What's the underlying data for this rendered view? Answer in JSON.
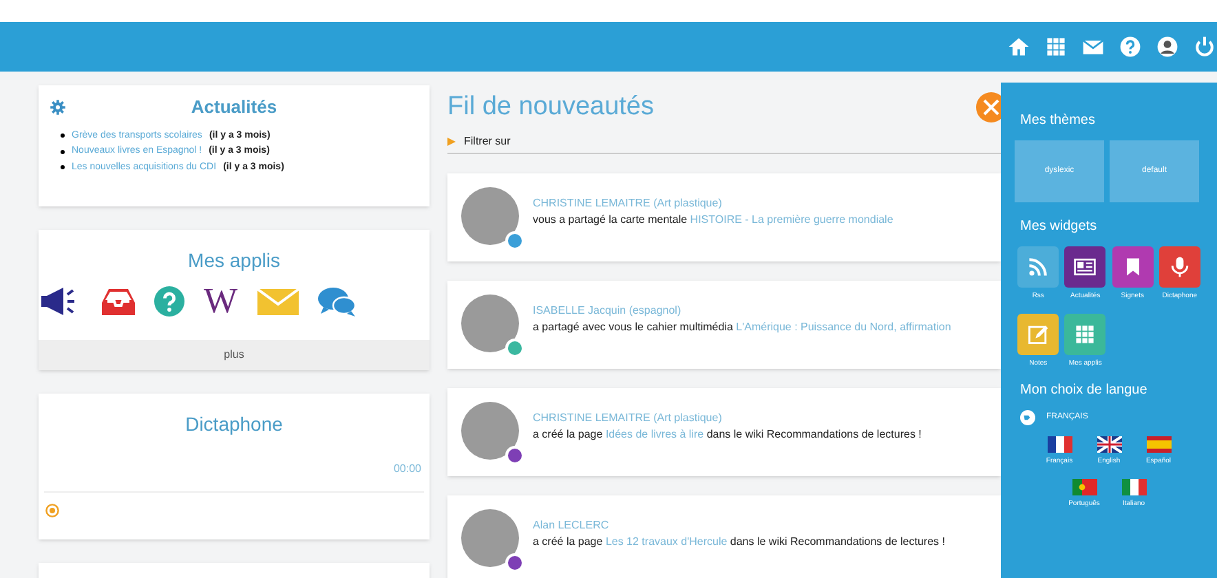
{
  "news": {
    "title": "Actualités",
    "items": [
      {
        "title": "Grève des transports scolaires",
        "time": "(il y a 3 mois)"
      },
      {
        "title": "Nouveaux livres en Espagnol !",
        "time": "(il y a 3 mois)"
      },
      {
        "title": "Les nouvelles acquisitions du CDI",
        "time": "(il y a 3 mois)"
      }
    ]
  },
  "apps": {
    "title": "Mes applis",
    "items": [
      {
        "kind": "megaphone"
      },
      {
        "kind": "inbox"
      },
      {
        "kind": "help"
      },
      {
        "kind": "wiki",
        "glyph": "W"
      },
      {
        "kind": "mail"
      },
      {
        "kind": "chat"
      }
    ],
    "more": "plus"
  },
  "dictaphone": {
    "title": "Dictaphone",
    "time": "00:00"
  },
  "feed": {
    "title": "Fil de nouveautés",
    "filter": "Filtrer sur",
    "items": [
      {
        "author": "CHRISTINE LEMAITRE (Art plastique)",
        "action": "vous a partagé la carte mentale ",
        "link": "HISTOIRE - La première guerre mondiale",
        "color": "#3b9fd8"
      },
      {
        "author": "ISABELLE Jacquin (espagnol)",
        "action": "a partagé avec vous le cahier multimédia ",
        "link": "L'Amérique : Puissance du Nord, affirmation",
        "color": "#3bb8a0"
      },
      {
        "author": "CHRISTINE LEMAITRE (Art plastique)",
        "action": "a créé la page ",
        "link": "Idées de livres à lire",
        "suffix": " dans le wiki Recommandations de lectures !",
        "color": "#7e3fb5"
      },
      {
        "author": "Alan LECLERC",
        "action": "a créé la page ",
        "link": "Les 12 travaux d'Hercule",
        "suffix": " dans le wiki Recommandations de lectures !",
        "color": "#7e3fb5"
      }
    ]
  },
  "panel": {
    "themes_title": "Mes thèmes",
    "themes": [
      "dyslexic",
      "default"
    ],
    "widgets_title": "Mes widgets",
    "widgets": [
      {
        "kind": "rss",
        "label": "Rss",
        "color": "#4cadd9"
      },
      {
        "kind": "news",
        "label": "Actualités",
        "color": "#6a2a8e"
      },
      {
        "kind": "bookmark",
        "label": "Signets",
        "color": "#b03ab0"
      },
      {
        "kind": "mic",
        "label": "Dictaphone",
        "color": "#e0403a"
      },
      {
        "kind": "notes",
        "label": "Notes",
        "color": "#e8b830"
      },
      {
        "kind": "apps",
        "label": "Mes applis",
        "color": "#3bb89a"
      }
    ],
    "language_title": "Mon choix de langue",
    "current_language": "FRANÇAIS",
    "languages": [
      {
        "kind": "fr",
        "label": "Français"
      },
      {
        "kind": "en",
        "label": "English"
      },
      {
        "kind": "es",
        "label": "Español"
      },
      {
        "kind": "pt",
        "label": "Português"
      },
      {
        "kind": "it",
        "label": "Italiano"
      }
    ]
  }
}
